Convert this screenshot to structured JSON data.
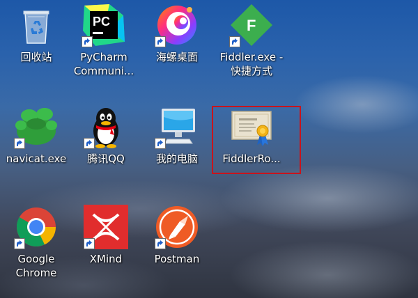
{
  "desktop": {
    "icons": [
      {
        "label": "回收站",
        "icon": "recycle-bin-icon",
        "shortcut": false
      },
      {
        "label": "PyCharm\nCommuni...",
        "icon": "pycharm-icon",
        "shortcut": true
      },
      {
        "label": "海螺桌面",
        "icon": "hailuo-icon",
        "shortcut": true
      },
      {
        "label": "Fiddler.exe -\n快捷方式",
        "icon": "fiddler-icon",
        "shortcut": true
      },
      {
        "label": "navicat.exe",
        "icon": "navicat-icon",
        "shortcut": true
      },
      {
        "label": "腾讯QQ",
        "icon": "qq-penguin-icon",
        "shortcut": true
      },
      {
        "label": "我的电脑",
        "icon": "computer-icon",
        "shortcut": true
      },
      {
        "label": "FiddlerRo...",
        "icon": "certificate-icon",
        "shortcut": false,
        "selected": true
      },
      {
        "label": "Google\nChrome",
        "icon": "chrome-icon",
        "shortcut": true
      },
      {
        "label": "XMind",
        "icon": "xmind-icon",
        "shortcut": true
      },
      {
        "label": "Postman",
        "icon": "postman-icon",
        "shortcut": true
      }
    ],
    "colors": {
      "highlight": "#c8141c",
      "fiddler_green": "#3cae4e",
      "postman_orange": "#ef5b25",
      "xmind_red": "#e12d2d"
    }
  }
}
